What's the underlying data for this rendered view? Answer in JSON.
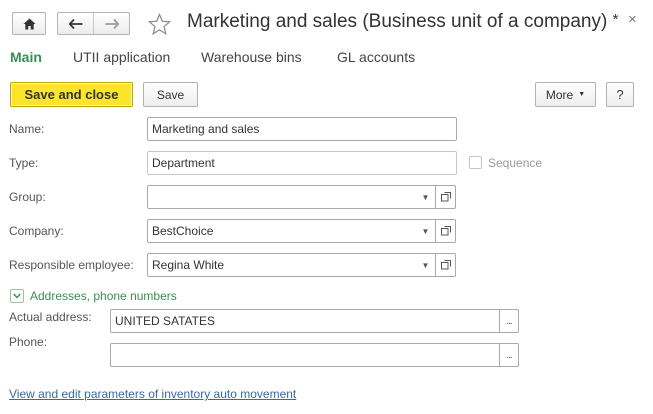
{
  "header": {
    "title": "Marketing and sales (Business unit of a company)",
    "modified_mark": "*",
    "close_glyph": "×"
  },
  "tabs": [
    {
      "label": "Main",
      "active": true
    },
    {
      "label": "UTII application",
      "active": false
    },
    {
      "label": "Warehouse bins",
      "active": false
    },
    {
      "label": "GL accounts",
      "active": false
    }
  ],
  "toolbar": {
    "save_and_close": "Save and close",
    "save": "Save",
    "more": "More",
    "help": "?"
  },
  "form": {
    "name_label": "Name:",
    "name_value": "Marketing and sales",
    "type_label": "Type:",
    "type_value": "Department",
    "sequence_label": "Sequence",
    "group_label": "Group:",
    "group_value": "",
    "company_label": "Company:",
    "company_value": "BestChoice",
    "responsible_label": "Responsible employee:",
    "responsible_value": "Regina White"
  },
  "addresses": {
    "section_label": "Addresses, phone numbers",
    "actual_address_label": "Actual address:",
    "actual_address_value": "UNITED SATATES",
    "phone_label": "Phone:",
    "phone_value": ""
  },
  "footer": {
    "link": "View and edit parameters of inventory auto movement"
  },
  "colors": {
    "accent_green": "#3a8e55",
    "primary_yellow": "#fbe52b",
    "link_blue": "#3a6a9e"
  }
}
